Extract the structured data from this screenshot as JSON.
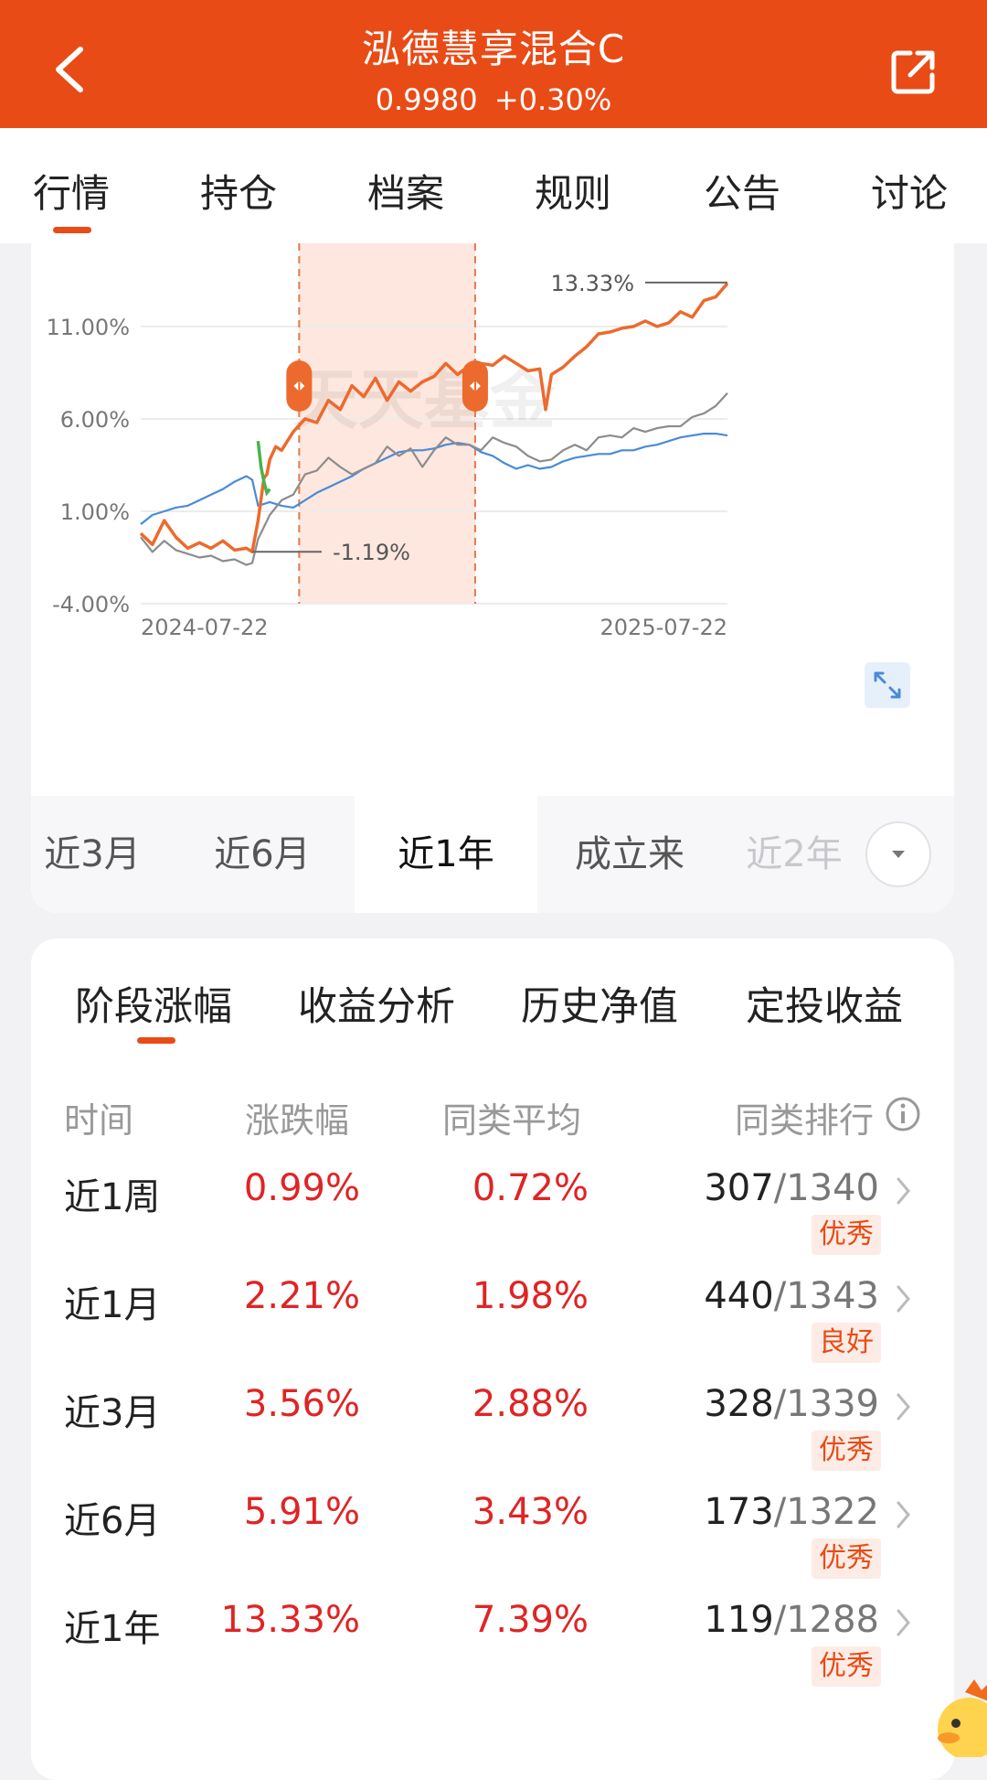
{
  "header": {
    "title": "泓德慧享混合C",
    "nav": "0.9980",
    "change": "+0.30%"
  },
  "tabs": [
    "行情",
    "持仓",
    "档案",
    "规则",
    "公告",
    "讨论"
  ],
  "range_tabs": [
    "近3月",
    "近6月",
    "近1年",
    "成立来",
    "近2年"
  ],
  "active_range": "近1年",
  "watermark": "天天基金",
  "perf_tabs": [
    "阶段涨幅",
    "收益分析",
    "历史净值",
    "定投收益"
  ],
  "table_headers": {
    "period": "时间",
    "change": "涨跌幅",
    "avg": "同类平均",
    "rank": "同类排行"
  },
  "rows": [
    {
      "period": "近1周",
      "change": "0.99%",
      "avg": "0.72%",
      "rank": "307",
      "total": "/1340",
      "badge": "优秀"
    },
    {
      "period": "近1月",
      "change": "2.21%",
      "avg": "1.98%",
      "rank": "440",
      "total": "/1343",
      "badge": "良好"
    },
    {
      "period": "近3月",
      "change": "3.56%",
      "avg": "2.88%",
      "rank": "328",
      "total": "/1339",
      "badge": "优秀"
    },
    {
      "period": "近6月",
      "change": "5.91%",
      "avg": "3.43%",
      "rank": "173",
      "total": "/1322",
      "badge": "优秀"
    },
    {
      "period": "近1年",
      "change": "13.33%",
      "avg": "7.39%",
      "rank": "119",
      "total": "/1288",
      "badge": "优秀"
    }
  ],
  "chart_data": {
    "type": "line",
    "x_start": "2024-07-22",
    "x_end": "2025-07-22",
    "y_ticks": [
      "11.00%",
      "6.00%",
      "1.00%",
      "-4.00%"
    ],
    "ylim": [
      -4,
      15.5
    ],
    "max_label": "13.33%",
    "min_label": "-1.19%",
    "highlight_range": [
      0.27,
      0.57
    ],
    "colors": {
      "fund": "#ec6a2d",
      "peer": "#8c8c8c",
      "index": "#4a8ad8",
      "drop": "#48b34a",
      "highlight": "#fde7df",
      "handle": "#ec6a2d"
    },
    "series": [
      {
        "key": "fund",
        "x": [
          0.0,
          0.02,
          0.04,
          0.06,
          0.08,
          0.1,
          0.12,
          0.14,
          0.16,
          0.18,
          0.19,
          0.2,
          0.21,
          0.215,
          0.22,
          0.23,
          0.24,
          0.26,
          0.28,
          0.3,
          0.32,
          0.34,
          0.36,
          0.38,
          0.4,
          0.42,
          0.44,
          0.46,
          0.48,
          0.5,
          0.52,
          0.54,
          0.56,
          0.58,
          0.6,
          0.62,
          0.64,
          0.66,
          0.68,
          0.69,
          0.7,
          0.72,
          0.74,
          0.76,
          0.78,
          0.8,
          0.82,
          0.84,
          0.86,
          0.88,
          0.9,
          0.92,
          0.94,
          0.96,
          0.98,
          1.0
        ],
        "values": [
          -0.2,
          -0.8,
          0.5,
          -0.4,
          -1.0,
          -0.7,
          -1.0,
          -0.6,
          -1.1,
          -1.0,
          -1.19,
          0.5,
          2.8,
          3.0,
          3.8,
          4.5,
          4.3,
          5.3,
          6.0,
          5.8,
          7.0,
          6.5,
          7.8,
          7.2,
          8.2,
          7.0,
          8.0,
          7.5,
          8.0,
          8.3,
          9.0,
          8.4,
          8.9,
          9.0,
          8.9,
          9.4,
          9.0,
          8.6,
          8.7,
          6.5,
          8.4,
          8.8,
          9.4,
          9.9,
          10.6,
          10.7,
          10.9,
          11.0,
          11.3,
          11.0,
          11.2,
          11.8,
          11.5,
          12.4,
          12.6,
          13.33
        ]
      },
      {
        "key": "peer",
        "x": [
          0.0,
          0.02,
          0.04,
          0.06,
          0.08,
          0.1,
          0.12,
          0.14,
          0.16,
          0.18,
          0.19,
          0.2,
          0.22,
          0.24,
          0.26,
          0.28,
          0.3,
          0.32,
          0.34,
          0.36,
          0.38,
          0.4,
          0.42,
          0.44,
          0.46,
          0.48,
          0.5,
          0.52,
          0.54,
          0.56,
          0.58,
          0.6,
          0.62,
          0.64,
          0.66,
          0.68,
          0.7,
          0.72,
          0.74,
          0.76,
          0.78,
          0.8,
          0.82,
          0.84,
          0.86,
          0.88,
          0.9,
          0.92,
          0.94,
          0.96,
          0.98,
          1.0
        ],
        "values": [
          -0.4,
          -1.2,
          -0.6,
          -1.1,
          -1.3,
          -1.5,
          -1.4,
          -1.7,
          -1.6,
          -1.9,
          -1.8,
          -0.5,
          0.8,
          1.6,
          1.9,
          3.0,
          3.2,
          3.9,
          3.4,
          3.0,
          3.3,
          3.6,
          4.5,
          4.0,
          4.4,
          3.4,
          4.3,
          5.0,
          4.6,
          4.6,
          4.3,
          5.0,
          4.7,
          4.5,
          4.0,
          3.7,
          3.8,
          4.3,
          4.6,
          4.3,
          5.0,
          5.1,
          5.0,
          5.5,
          5.3,
          5.5,
          5.6,
          5.6,
          6.1,
          6.3,
          6.7,
          7.4
        ]
      },
      {
        "key": "index",
        "x": [
          0.0,
          0.02,
          0.04,
          0.06,
          0.08,
          0.1,
          0.12,
          0.14,
          0.16,
          0.18,
          0.19,
          0.2,
          0.22,
          0.24,
          0.26,
          0.28,
          0.3,
          0.32,
          0.34,
          0.36,
          0.38,
          0.4,
          0.42,
          0.44,
          0.46,
          0.48,
          0.5,
          0.52,
          0.54,
          0.56,
          0.58,
          0.6,
          0.62,
          0.64,
          0.66,
          0.68,
          0.7,
          0.72,
          0.74,
          0.76,
          0.78,
          0.8,
          0.82,
          0.84,
          0.86,
          0.88,
          0.9,
          0.92,
          0.94,
          0.96,
          0.98,
          1.0
        ],
        "values": [
          0.3,
          0.8,
          1.0,
          1.2,
          1.3,
          1.6,
          1.9,
          2.2,
          2.6,
          2.9,
          2.7,
          1.3,
          1.5,
          1.3,
          1.2,
          1.6,
          2.0,
          2.3,
          2.6,
          2.9,
          3.3,
          3.6,
          3.9,
          4.2,
          4.3,
          4.3,
          4.4,
          4.6,
          4.7,
          4.6,
          4.2,
          4.0,
          3.6,
          3.3,
          3.5,
          3.3,
          3.4,
          3.7,
          3.9,
          4.0,
          4.1,
          4.1,
          4.3,
          4.3,
          4.5,
          4.6,
          4.8,
          5.0,
          5.1,
          5.2,
          5.2,
          5.1
        ]
      }
    ],
    "drop_segment": {
      "x": [
        0.2,
        0.205,
        0.21,
        0.215,
        0.22
      ],
      "values": [
        4.8,
        3.4,
        2.6,
        2.0,
        2.2
      ]
    }
  }
}
